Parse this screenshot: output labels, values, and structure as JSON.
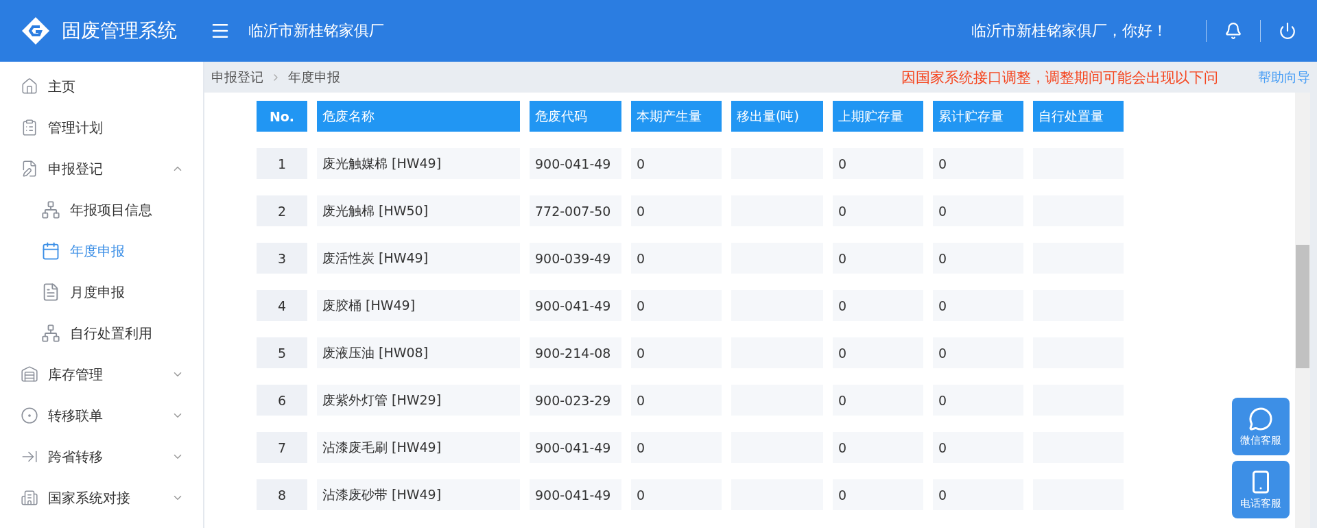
{
  "header": {
    "app_title": "固废管理系统",
    "company": "临沂市新桂铭家俱厂",
    "greeting": "临沂市新桂铭家俱厂，你好！"
  },
  "sidebar": {
    "items": [
      {
        "label": "主页",
        "selected": false
      },
      {
        "label": "管理计划",
        "selected": false
      },
      {
        "label": "申报登记",
        "selected": false,
        "expanded": true,
        "children": [
          {
            "label": "年报项目信息",
            "selected": false
          },
          {
            "label": "年度申报",
            "selected": true
          },
          {
            "label": "月度申报",
            "selected": false
          },
          {
            "label": "自行处置利用",
            "selected": false
          }
        ]
      },
      {
        "label": "库存管理",
        "selected": false,
        "expanded": false
      },
      {
        "label": "转移联单",
        "selected": false,
        "expanded": false
      },
      {
        "label": "跨省转移",
        "selected": false,
        "expanded": false
      },
      {
        "label": "国家系统对接",
        "selected": false,
        "expanded": false
      }
    ]
  },
  "breadcrumb": [
    "申报登记",
    "年度申报"
  ],
  "notice": "因国家系统接口调整，调整期间可能会出现以下问",
  "help_link": "帮助向导",
  "table": {
    "columns": [
      "No.",
      "危废名称",
      "危废代码",
      "本期产生量",
      "移出量(吨)",
      "上期贮存量",
      "累计贮存量",
      "自行处置量"
    ],
    "rows": [
      [
        "1",
        "废光触媒棉 [HW49]",
        "900-041-49",
        "0",
        null,
        "0",
        "0",
        null
      ],
      [
        "2",
        "废光触棉 [HW50]",
        "772-007-50",
        "0",
        null,
        "0",
        "0",
        null
      ],
      [
        "3",
        "废活性炭 [HW49]",
        "900-039-49",
        "0",
        null,
        "0",
        "0",
        null
      ],
      [
        "4",
        "废胶桶 [HW49]",
        "900-041-49",
        "0",
        null,
        "0",
        "0",
        null
      ],
      [
        "5",
        "废液压油 [HW08]",
        "900-214-08",
        "0",
        null,
        "0",
        "0",
        null
      ],
      [
        "6",
        "废紫外灯管 [HW29]",
        "900-023-29",
        "0",
        null,
        "0",
        "0",
        null
      ],
      [
        "7",
        "沾漆废毛刷 [HW49]",
        "900-041-49",
        "0",
        null,
        "0",
        "0",
        null
      ],
      [
        "8",
        "沾漆废砂带 [HW49]",
        "900-041-49",
        "0",
        null,
        "0",
        "0",
        null
      ]
    ]
  },
  "float_buttons": [
    "微信客服",
    "电话客服"
  ]
}
